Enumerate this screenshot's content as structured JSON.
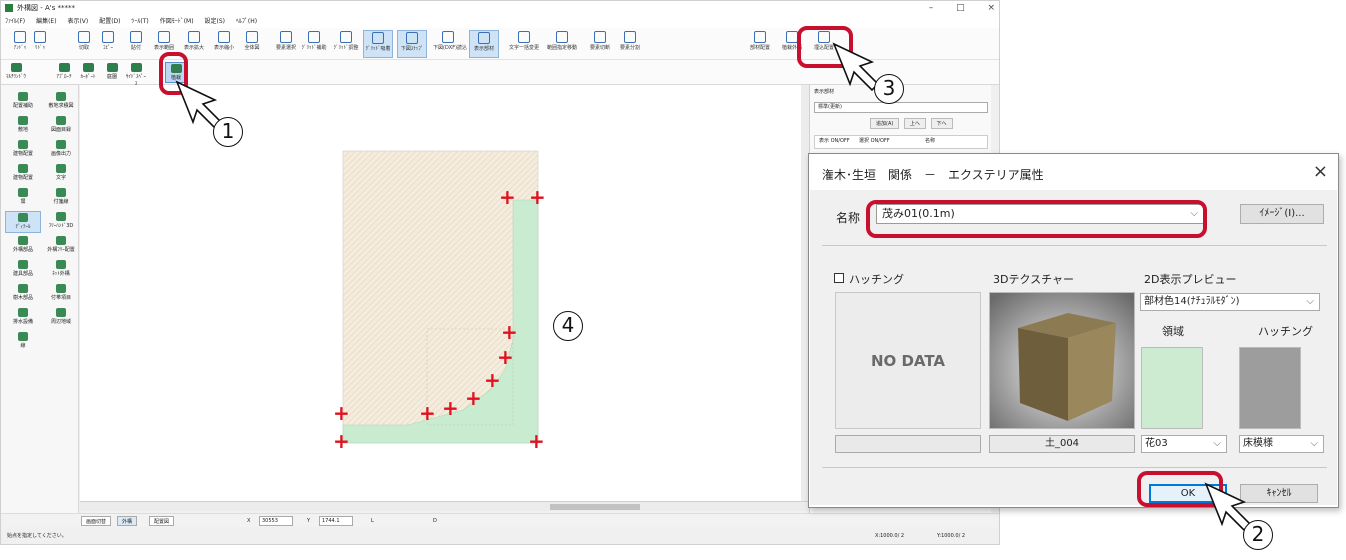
{
  "app": {
    "title": "外構図 - A's *****",
    "window_controls": [
      "–",
      "□",
      "×"
    ],
    "menu": [
      "ﾌｧｲﾙ(F)",
      "編集(E)",
      "表示(V)",
      "配置(D)",
      "ﾂｰﾙ(T)",
      "作図ﾓｰﾄﾞ(M)",
      "設定(S)",
      "ﾍﾙﾌﾟ(H)"
    ]
  },
  "toolbar": [
    "ｱﾝﾄﾞｩ",
    "ﾘﾄﾞｩ",
    "切取",
    "ｺﾋﾟｰ",
    "貼付",
    "表示範囲",
    "表示拡大",
    "表示縮小",
    "全体図",
    "要素選択",
    "ｸﾞﾘｯﾄﾞ補助",
    "ｸﾞﾘｯﾄﾞ調整",
    "ｸﾞﾘｯﾄﾞ吸着",
    "下図ｽﾅｯﾌﾟ",
    "下図(DXF)読込",
    "表示部材",
    "文字一括変更",
    "範囲指定移動",
    "要素切断",
    "要素分割",
    "部材配置",
    "植栽外構",
    "埋込配置"
  ],
  "toolbar2": [
    "ﾏﾙﾁﾜﾝﾄﾞｳ",
    "ｱﾌﾟﾛｰﾁ",
    "ｶｰﾎﾟｰﾄ",
    "庭園",
    "ｻｲﾄﾞｽﾍﾟｰｽ",
    "植栽"
  ],
  "left_panel": [
    "配置補助",
    "敷地求積図",
    "敷地",
    "図面目録",
    "建物配置",
    "画像出力",
    "建物配置",
    "文字",
    "塀",
    "付箋線",
    "ﾃﾞｨﾃｰﾙ",
    "ﾌﾘｰﾊﾝﾄﾞ3D",
    "外構部品",
    "外構ﾌﾘｰ配置",
    "建具部品",
    "ﾈｯﾄ外構",
    "樹木部品",
    "付帯項目",
    "排水設備",
    "周辺地域",
    "線"
  ],
  "right_panel": {
    "title": "表示部材",
    "select_value": "標準(更新)",
    "buttons": [
      "追加(A)",
      "上へ",
      "下へ"
    ],
    "columns": [
      "表示 ON/OFF",
      "選択 ON/OFF",
      "名称"
    ]
  },
  "statusbar": {
    "tabs": [
      "画面切替",
      "外構",
      "配置図"
    ],
    "x_label": "X",
    "x_value": "30553",
    "y_label": "Y",
    "y_value": "1744.1",
    "l_label": "L",
    "d_label": "D",
    "hint": "始点を指定してください。",
    "scale_x": "X:1000.0/ 2",
    "scale_y": "Y:1000.0/ 2"
  },
  "dialog": {
    "title": "潅木･生垣　関係　－　エクステリア属性",
    "close": "×",
    "name_label": "名称",
    "name_value": "茂み01(0.1m)",
    "image_button": "ｲﾒｰｼﾞ(I)...",
    "hatching_label": "ハッチング",
    "texture_label": "3Dテクスチャー",
    "preview_label": "2D表示プレビュー",
    "no_data": "NO DATA",
    "preview_select": "部材色14(ﾅﾁｭﾗﾙﾓﾀﾞﾝ)",
    "region_label": "領域",
    "hatching_col_label": "ハッチング",
    "texture_name": "土_004",
    "region_value": "花03",
    "hatching_value": "床模様",
    "ok": "OK",
    "cancel": "ｷｬﾝｾﾙ",
    "colors": {
      "region_swatch": "#cdebd0",
      "hatch_swatch": "#9d9d9d"
    }
  },
  "callouts": [
    "1",
    "2",
    "3",
    "4"
  ],
  "drawing": {
    "fill_region": "#f3ecdf",
    "green_region": "#c9ebd0",
    "marker_color": "#e0121f"
  }
}
